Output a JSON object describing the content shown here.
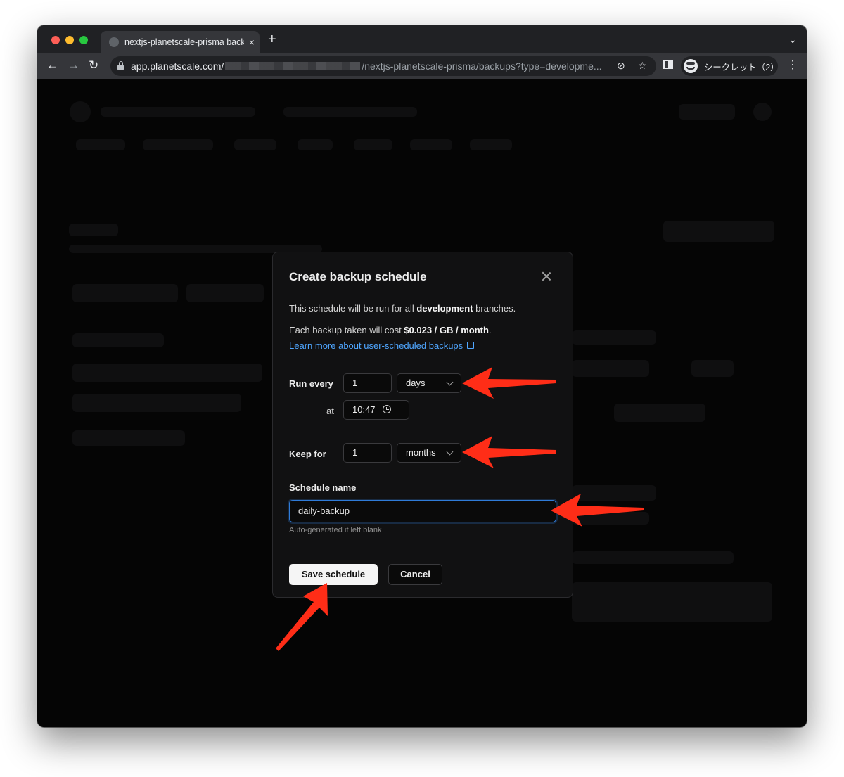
{
  "browser": {
    "tab_title": "nextjs-planetscale-prisma backups",
    "tab_close": "×",
    "new_tab": "+",
    "tab_list": "⌄",
    "nav_back": "←",
    "nav_forward": "→",
    "nav_reload": "↻",
    "url_host": "app.planetscale.com/",
    "url_path": "/nextjs-planetscale-prisma/backups?type=developme...",
    "eye_off_icon": "⊘",
    "bookmark_star": "☆",
    "incognito_label": "シークレット（2）",
    "menu_dots": "⋮"
  },
  "modal": {
    "title": "Create backup schedule",
    "run_for_prefix": "This schedule will be run for all ",
    "run_for_branch": "development",
    "run_for_suffix": " branches.",
    "cost_prefix": "Each backup taken will cost ",
    "cost_value": "$0.023 / GB / month",
    "cost_suffix": ".",
    "learn_more": "Learn more about user-scheduled backups",
    "run_every_label": "Run every",
    "run_every_value": "1",
    "run_every_unit": "days",
    "at_label": "at",
    "at_time": "10:47",
    "keep_for_label": "Keep for",
    "keep_for_value": "1",
    "keep_for_unit": "months",
    "schedule_name_label": "Schedule name",
    "schedule_name_value": "daily-backup",
    "schedule_name_hint": "Auto-generated if left blank",
    "save_button": "Save schedule",
    "cancel_button": "Cancel"
  },
  "colors": {
    "annotation_arrow": "#ff2d17",
    "link": "#4fa6ff",
    "focus_ring": "#2f7bd8"
  }
}
